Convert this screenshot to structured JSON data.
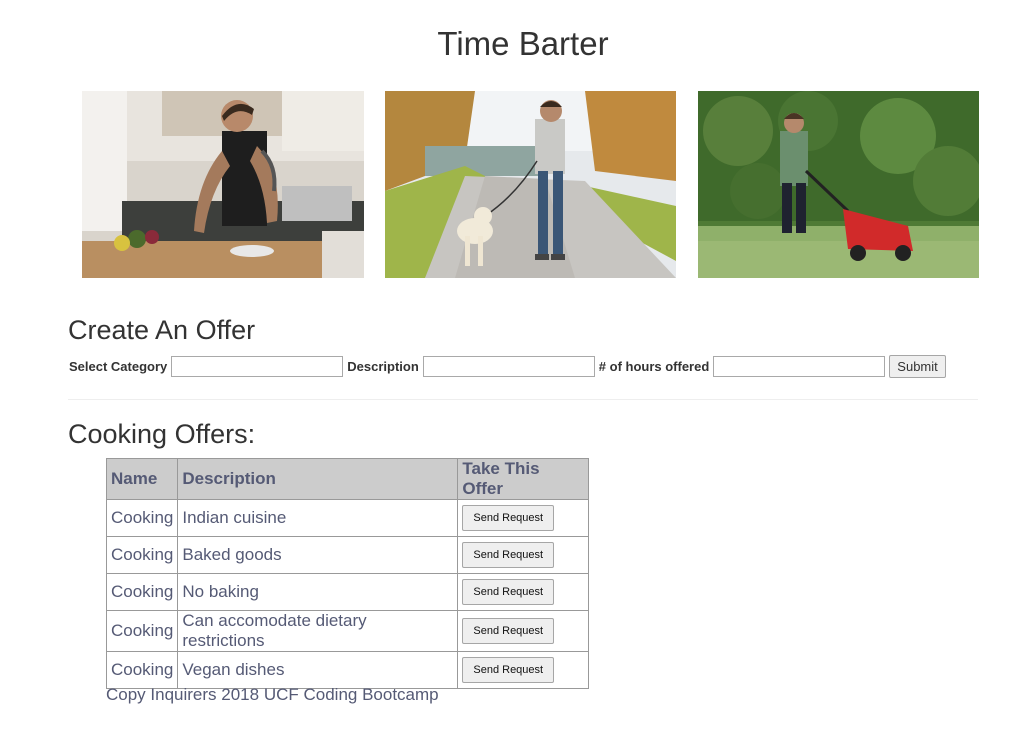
{
  "site": {
    "title": "Time Barter"
  },
  "photos": [
    {
      "name": "man cooking in kitchen"
    },
    {
      "name": "man walking dog"
    },
    {
      "name": "person mowing lawn"
    }
  ],
  "create_offer": {
    "heading": "Create An Offer",
    "category_label": "Select Category",
    "category_value": "",
    "description_label": "Description",
    "description_value": "",
    "hours_label": "# of hours offered",
    "hours_value": "",
    "submit_label": "Submit"
  },
  "offers": {
    "heading": "Cooking Offers:",
    "columns": [
      "Name",
      "Description",
      "Take This Offer"
    ],
    "rows": [
      {
        "name": "Cooking",
        "description": "Indian cuisine",
        "action": "Send Request"
      },
      {
        "name": "Cooking",
        "description": "Baked goods",
        "action": "Send Request"
      },
      {
        "name": "Cooking",
        "description": "No baking",
        "action": "Send Request"
      },
      {
        "name": "Cooking",
        "description": "Can accomodate dietary restrictions",
        "action": "Send Request"
      },
      {
        "name": "Cooking",
        "description": "Vegan dishes",
        "action": "Send Request"
      }
    ]
  },
  "footer": {
    "text": "Copy Inquirers 2018 UCF Coding Bootcamp"
  }
}
